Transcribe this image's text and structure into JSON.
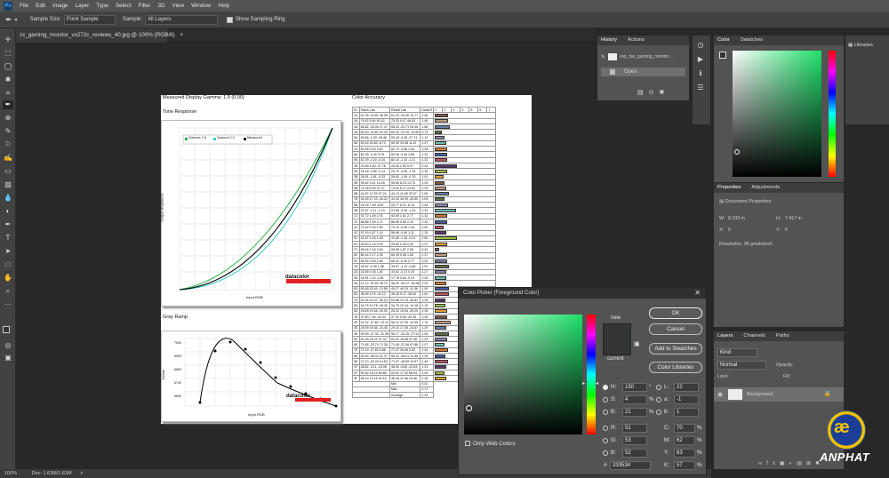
{
  "app": {
    "logo": "Ps"
  },
  "menu": [
    "File",
    "Edit",
    "Image",
    "Layer",
    "Type",
    "Select",
    "Filter",
    "3D",
    "View",
    "Window",
    "Help"
  ],
  "options": {
    "sample_size_label": "Sample Size:",
    "sample_size_value": "Point Sample",
    "sample_label": "Sample:",
    "sample_value": "All Layers",
    "show_ring_label": "Show Sampling Ring"
  },
  "document_tab": {
    "title": "zx_gaming_monitor_vx272c_reviews_40.jpg @ 100% (RGB/8)",
    "close": "×"
  },
  "status": {
    "zoom": "100%",
    "doc": "Doc: 1.63M/1.63M",
    "arrow": ">"
  },
  "report": {
    "gamma_title": "Measured Display Gamma: 1.9 (0.00)",
    "tone_title": "Tone Response",
    "tone_xlabel": "Input RGB",
    "tone_ylabel": "Output Brightness",
    "legend": [
      "Gamma 1.8",
      "Gamma 2.2",
      "Measured"
    ],
    "brand": "datacolor",
    "gray_title": "Gray Ramp",
    "gray_xlabel": "Input RGB",
    "gray_ylabel": "Kelvin",
    "gray_yticks": [
      "7000",
      "6900",
      "6800",
      "6700",
      "6600",
      "6500"
    ],
    "accuracy_title": "Color Accuracy",
    "accuracy_headers": [
      "ID",
      "Patch Lab",
      "Result Lab",
      "Delta-E"
    ],
    "accuracy_rows": [
      [
        "1A",
        "61.35 -34.81 38.38",
        "61.23 -33.50 15.77",
        "1.46"
      ],
      [
        "2A",
        "79.92 5.84 92.42",
        "75.33 5.07 46.83",
        "1.48"
      ],
      [
        "3A",
        "66.82 -25.06 27.47",
        "66.43 -20.71 26.96",
        "1.66"
      ],
      [
        "4A",
        "60.53 -22.82 20.40",
        "60.04 -23.39 -19.80",
        "0.73"
      ],
      [
        "5A",
        "59.66 -2.03 -28.46",
        "59.18 -3.45 -27.74",
        "1.10"
      ],
      [
        "6A",
        "59.15 30.83 -8.72",
        "59.05 29.38 -8.12",
        "1.27"
      ],
      [
        "7A",
        "82.69 0.33 3.52",
        "82.70 -3.88 2.63",
        "1.34"
      ],
      [
        "8A",
        "82.25 -2.42 3.78",
        "82.26 -3.46 3.66",
        "1.32"
      ],
      [
        "9A",
        "82.29 -2.20 -0.34",
        "82.14 -1.24 -1.21",
        "1.33"
      ],
      [
        "1B",
        "24.69 4.43 -37.78",
        "25.54 2.55 0.07",
        "2.43"
      ],
      [
        "2B",
        "25.16 -3.85 -2.13",
        "25.75 -4.96 -1.78",
        "1.35"
      ],
      [
        "3B",
        "26.51 -1.61 -0.03",
        "26.82 -1.26 -0.76",
        "1.01"
      ],
      [
        "4B",
        "95.62 9.41 14.49",
        "95.65 8.23 13.75",
        "1.09"
      ],
      [
        "5B",
        "74.28 9.09 37.27",
        "74.00 8.17 24.52",
        "1.29"
      ],
      [
        "6B",
        "44.57 12.39 37.24",
        "44.13 11.65 33.37",
        "1.55"
      ],
      [
        "7B",
        "44.49 17.23 -26.24",
        "44.42 16.39 -25.60",
        "1.04"
      ],
      [
        "8B",
        "25.29 7.95 -8.87",
        "25.77 6.37 -8.14",
        "1.45"
      ],
      [
        "9B",
        "22.67 -2.11 -1.10",
        "23.56 -3.26 -1.24",
        "2.32"
      ],
      [
        "1C",
        "92.72 1.89 2.76",
        "92.69 1.61 2.77",
        "1.32"
      ],
      [
        "2C",
        "88.85 1.59 2.27",
        "88.96 0.66 2.19",
        "1.32"
      ],
      [
        "3C",
        "73.42 0.99 1.89",
        "73.14 -0.08 1.94",
        "1.00"
      ],
      [
        "4C",
        "57.15 0.57 1.19",
        "56.96 -0.60 1.11",
        "1.25"
      ],
      [
        "5C",
        "41.57 0.24 1.45",
        "41.69 -1.18 -0.01",
        "2.50"
      ],
      [
        "6C",
        "25.63 1.24 0.05",
        "25.82 0.28 0.30",
        "1.37"
      ],
      [
        "7C",
        "96.04 2.16 2.60",
        "95.96 1.87 2.98",
        "0.42"
      ],
      [
        "8C",
        "80.44 1.17 2.05",
        "80.25 0.36 1.63",
        "1.37"
      ],
      [
        "9C",
        "65.52 0.69 1.86",
        "66.11 -0.26 0.77",
        "1.32"
      ],
      [
        "1D",
        "49.62 -0.45 1.56",
        "49.97 -1.12 -0.88",
        "1.57"
      ],
      [
        "2D",
        "33.55 0.35 1.40",
        "33.62 -0.37 0.25",
        "1.27"
      ],
      [
        "3D",
        "16.91 1.43 -0.81",
        "17.78 0.64 -0.24",
        "1.26"
      ],
      [
        "4D",
        "47.12 -32.52 28.79",
        "46.29 -30.37 -26.98",
        "1.29"
      ],
      [
        "5D",
        "50.49 53.45 -13.55",
        "49.27 49.29 -11.56",
        "1.59"
      ],
      [
        "6D",
        "36.94 9.76 -41.12",
        "36.40 9.17 -39.00",
        "1.61"
      ],
      [
        "7D",
        "63.34 24.37 -36.24",
        "62.68 23.75 -36.82",
        "1.19"
      ],
      [
        "8D",
        "34.75 13.78 -18.49",
        "34.79 12.14 -14.16",
        "1.19"
      ],
      [
        "9D",
        "28.89 19.48 -39.30",
        "28.32 15.64 -39.25",
        "1.35"
      ],
      [
        "1E",
        "37.80 7.30 -43.04",
        "37.91 5.99 -42.39",
        "1.35"
      ],
      [
        "2E",
        "51.02 -47.60 -14.12",
        "50.21 47.94 -13.96",
        "1.75"
      ],
      [
        "3E",
        "28.59 19.36 -24.48",
        "29.23 17.26 -23.67",
        "1.29"
      ],
      [
        "4E",
        "55.99 -37.31 -31.36",
        "55.17 -33.26 -27.91",
        "1.54"
      ],
      [
        "5E",
        "61.99 18.21 57.33",
        "62.02 18.08 57.98",
        "1.33"
      ],
      [
        "6E",
        "71.65 -23.74 72.28",
        "71.45 -22.56 67.88",
        "1.07"
      ],
      [
        "7E",
        "71.19 -27.63 0.86",
        "71.07 26.06 2.82",
        "1.42"
      ],
      [
        "8E",
        "55.52 -38.34 31.37",
        "55.31 -38.01 31.56",
        "1.15"
      ],
      [
        "9E",
        "72.13 -20.33 14.53",
        "71.97 -18.65 13.97",
        "1.49"
      ],
      [
        "1F",
        "48.82 -5.11 -23.08",
        "48.54 -5.84 -22.63",
        "1.23"
      ],
      [
        "2F",
        "60.52 18.14 65.88",
        "60.62 17.32 66.64",
        "1.04"
      ],
      [
        "3F",
        "36.14 13.15 24.15",
        "36.45 11.98 24.46",
        "1.28"
      ]
    ],
    "accuracy_summary": [
      [
        "Min",
        "0.42"
      ],
      [
        "Max",
        "3.17"
      ],
      [
        "Average",
        "1.43"
      ]
    ],
    "delta_scale": [
      "1",
      "2",
      "3",
      "4",
      "5",
      "6",
      "7"
    ]
  },
  "history": {
    "tabs": [
      "History",
      "Actions"
    ],
    "snapshot_name": "vsp_fax_gaming_monitor...",
    "items": [
      "Open"
    ]
  },
  "color_panel": {
    "tabs": [
      "Color",
      "Swatches"
    ]
  },
  "libraries": {
    "label": "Libraries"
  },
  "properties": {
    "tabs": [
      "Properties",
      "Adjustments"
    ],
    "title": "Document Properties",
    "w_label": "W:",
    "w_value": "8.333 in",
    "h_label": "H:",
    "h_value": "7.417 in",
    "x_label": "X:",
    "x_value": "0",
    "y_label": "Y:",
    "y_value": "0",
    "resolution": "Resolution: 96 pixels/inch"
  },
  "layers": {
    "tabs": [
      "Layers",
      "Channels",
      "Paths"
    ],
    "kind_placeholder": "Kind",
    "blend": "Normal",
    "opacity_label": "Opacity:",
    "lock_label": "Lock:",
    "fill_label": "Fill:",
    "layer_name": "Background"
  },
  "color_picker": {
    "title": "Color Picker (Foreground Color)",
    "new_label": "new",
    "current_label": "current",
    "ok": "OK",
    "cancel": "Cancel",
    "add_swatches": "Add to Swatches",
    "color_libraries": "Color Libraries",
    "H_label": "H:",
    "H_value": "150",
    "H_unit": "°",
    "S_label": "S:",
    "S_value": "4",
    "S_unit": "%",
    "B_label": "B:",
    "B_value": "21",
    "B_unit": "%",
    "R_label": "R:",
    "R_value": "51",
    "G_label": "G:",
    "G_value": "53",
    "Bl_label": "B:",
    "Bl_value": "52",
    "L_label": "L:",
    "L_value": "22",
    "a_label": "a:",
    "a_value": "-1",
    "b_label": "b:",
    "b_value": "1",
    "C_label": "C:",
    "C_value": "70",
    "C_unit": "%",
    "M_label": "M:",
    "M_value": "62",
    "M_unit": "%",
    "Y_label": "Y:",
    "Y_value": "63",
    "Y_unit": "%",
    "K_label": "K:",
    "K_value": "57",
    "K_unit": "%",
    "hex_label": "#",
    "hex_value": "333534",
    "web_only_label": "Only Web Colors",
    "swatch_color": "#333534"
  },
  "watermark": {
    "text": "ANPHAT"
  }
}
